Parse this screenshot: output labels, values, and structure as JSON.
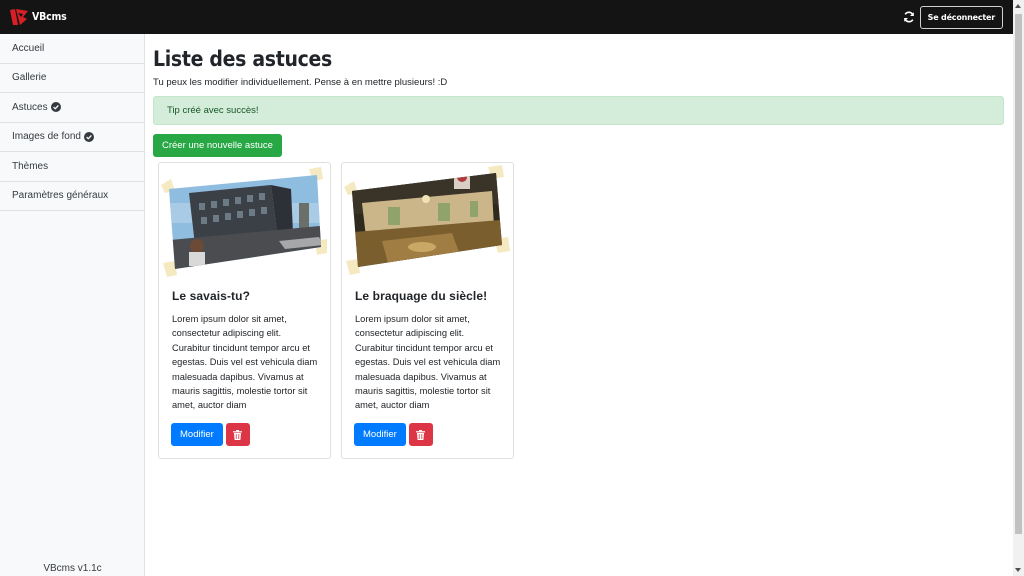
{
  "app": {
    "name": "VBcms",
    "logout_label": "Se déconnecter",
    "version": "VBcms v1.1c"
  },
  "sidebar": {
    "items": [
      {
        "label": "Accueil",
        "icon": null
      },
      {
        "label": "Gallerie",
        "icon": null
      },
      {
        "label": "Astuces",
        "icon": "check-circle-icon"
      },
      {
        "label": "Images de fond",
        "icon": "check-circle-icon"
      },
      {
        "label": "Thèmes",
        "icon": null
      },
      {
        "label": "Paramètres généraux",
        "icon": null
      }
    ]
  },
  "main": {
    "title": "Liste des astuces",
    "subtitle": "Tu peux les modifier individuellement. Pense à en mettre plusieurs! :D",
    "alert": "Tip créé avec succès!",
    "create_label": "Créer une nouvelle astuce"
  },
  "cards": [
    {
      "title": "Le savais-tu?",
      "text": "Lorem ipsum dolor sit amet, consectetur adipiscing elit. Curabitur tincidunt tempor arcu et egestas. Duis vel est vehicula diam malesuada dapibus. Vivamus at mauris sagittis, molestie tortor sit amet, auctor diam",
      "edit_label": "Modifier",
      "image": "street-scene-screenshot"
    },
    {
      "title": "Le braquage du siècle!",
      "text": "Lorem ipsum dolor sit amet, consectetur adipiscing elit. Curabitur tincidunt tempor arcu et egestas. Duis vel est vehicula diam malesuada dapibus. Vivamus at mauris sagittis, molestie tortor sit amet, auctor diam",
      "edit_label": "Modifier",
      "image": "casino-interior-screenshot"
    }
  ],
  "colors": {
    "navbar": "#141414",
    "brand_red": "#d91f26",
    "success_button": "#28a745",
    "primary_button": "#007bff",
    "danger_button": "#dc3545",
    "alert_bg": "#d4edda",
    "alert_text": "#155724"
  }
}
